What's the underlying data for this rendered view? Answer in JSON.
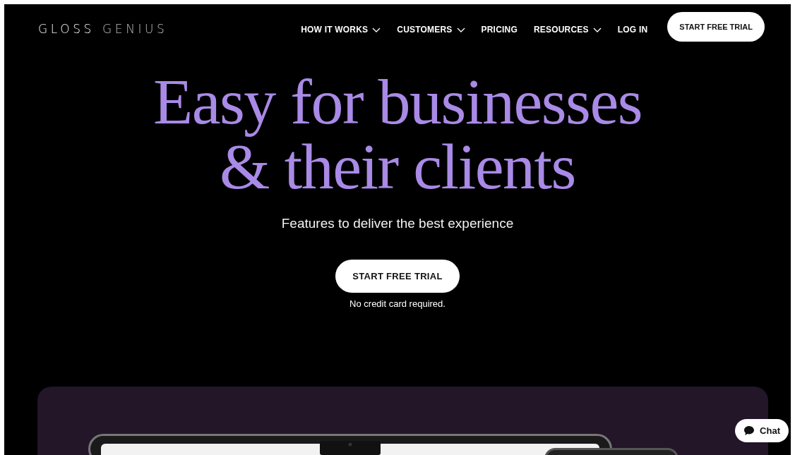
{
  "header": {
    "logo": {
      "primary": "GLOSS",
      "secondary": "GENIUS"
    },
    "nav": [
      {
        "label": "HOW IT WORKS",
        "dropdown": true
      },
      {
        "label": "CUSTOMERS",
        "dropdown": true
      },
      {
        "label": "PRICING",
        "dropdown": false
      },
      {
        "label": "RESOURCES",
        "dropdown": true
      },
      {
        "label": "LOG IN",
        "dropdown": false
      }
    ],
    "cta": "START FREE TRIAL"
  },
  "hero": {
    "headline": [
      "Easy for businesses",
      "& their clients"
    ],
    "subtitle": "Features to deliver the best experience",
    "cta": "START FREE TRIAL",
    "note": "No credit card required."
  },
  "chat": {
    "label": "Chat"
  }
}
